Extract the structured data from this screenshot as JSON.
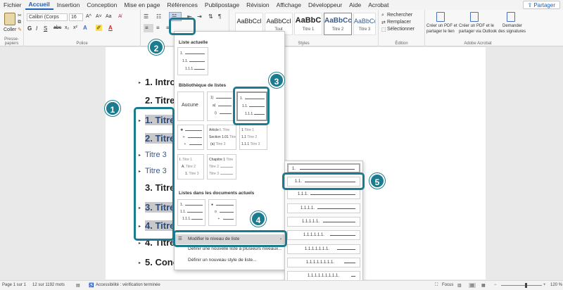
{
  "menu": {
    "items": [
      "Fichier",
      "Accueil",
      "Insertion",
      "Conception",
      "Mise en page",
      "Références",
      "Publipostage",
      "Révision",
      "Affichage",
      "Développeur",
      "Aide",
      "Acrobat"
    ],
    "active_index": 1,
    "share_label": "Partager"
  },
  "ribbon": {
    "clipboard": {
      "paste_label": "Coller",
      "group_label": "Presse-papiers"
    },
    "font": {
      "font_name": "Calibri (Corps",
      "font_size": "16",
      "group_label": "Police",
      "bold": "G",
      "italic": "I",
      "underline": "S",
      "strike": "abc",
      "sub": "x₂",
      "sup": "x²",
      "grow": "A^",
      "shrink": "A˅",
      "case": "Aa",
      "highlight": "A"
    },
    "paragraph": {
      "pilcrow": "¶"
    },
    "styles": {
      "group_label": "Styles",
      "items": [
        {
          "preview": "AaBbCcl",
          "name": "Normal"
        },
        {
          "preview": "AaBbCcl",
          "name": "Tout"
        },
        {
          "preview": "AaBbC",
          "name": "Titre 1"
        },
        {
          "preview": "AaBbCc",
          "name": "Titre 2"
        },
        {
          "preview": "AaBbCcl",
          "name": "Titre 3"
        }
      ]
    },
    "editing": {
      "find": "Rechercher",
      "replace": "Remplacer",
      "select": "Sélectionner",
      "group_label": "Édition"
    },
    "acrobat": {
      "group_label": "Adobe Acrobat",
      "btn1_line1": "Créer un PDF et",
      "btn1_line2": "partager le lien",
      "btn2_line1": "Créer un PDF et le",
      "btn2_line2": "partager via Outlook",
      "btn3_line1": "Demander",
      "btn3_line2": "des signatures"
    }
  },
  "document": {
    "headings": [
      {
        "text": "1. Intro"
      },
      {
        "text": "2. Titre"
      },
      {
        "text": "1. Titre"
      },
      {
        "text": "2. Titre"
      },
      {
        "text": "Titre 3"
      },
      {
        "text": "Titre 3"
      },
      {
        "text": "3. Titre"
      },
      {
        "text": "3. Titre"
      },
      {
        "text": "4. Titre"
      },
      {
        "text": "4. Titre"
      },
      {
        "text": "5. Conc"
      }
    ]
  },
  "dropdown": {
    "current_list_header": "Liste actuelle",
    "current_list_lines": [
      "1.",
      "1.1.",
      "1.1.1."
    ],
    "library_header": "Bibliothèque de listes",
    "none_label": "Aucune",
    "tile_paren": [
      "1)",
      "a)",
      "i)"
    ],
    "tile_decimal": [
      "1.",
      "1.1.",
      "1.1.1."
    ],
    "tile_article": [
      "Article I.",
      "Section 1.01",
      "(a)"
    ],
    "tile_article_suffix": [
      "Titre",
      "Titre",
      "Titre 3"
    ],
    "tile_titre_num": [
      "1",
      "1.1",
      "1.1.1"
    ],
    "tile_titre_num_suffix": [
      "Titre 1",
      "Titre 2",
      "Titre 3"
    ],
    "tile_alpha": [
      "I.",
      "A.",
      "1."
    ],
    "tile_alpha_suffix": [
      "Titre 1",
      "Titre 2",
      "Titre 3"
    ],
    "tile_chapitre": [
      "Chapitre 1",
      "Titre 2",
      "Titre 3"
    ],
    "tile_chapitre_suffix": "Titre",
    "doc_lists_header": "Listes dans les documents actuels",
    "doc_list_lines": [
      "1.",
      "1.1.",
      "1.1.1."
    ],
    "change_level": "Modifier le niveau de liste",
    "define_new_multilevel": "Définir une nouvelle liste à plusieurs niveaux...",
    "define_new_style": "Définir un nouveau style de liste..."
  },
  "submenu": {
    "levels": [
      "1.",
      "1.1.",
      "1.1.1.",
      "1.1.1.1.",
      "1.1.1.1.1.",
      "1.1.1.1.1.1.",
      "1.1.1.1.1.1.1.",
      "1.1.1.1.1.1.1.1.",
      "1.1.1.1.1.1.1.1.1."
    ]
  },
  "callouts": [
    "1",
    "2",
    "3",
    "4",
    "5"
  ],
  "status": {
    "page": "Page 1 sur 1",
    "words": "12 sur 1192 mots",
    "accessibility": "Accessibilité : vérification terminée",
    "focus": "Focus",
    "zoom": "120 %"
  },
  "colors": {
    "accent": "#1b7c8f",
    "brand": "#1a5fb4",
    "heading_blue": "#2b4a7a"
  }
}
